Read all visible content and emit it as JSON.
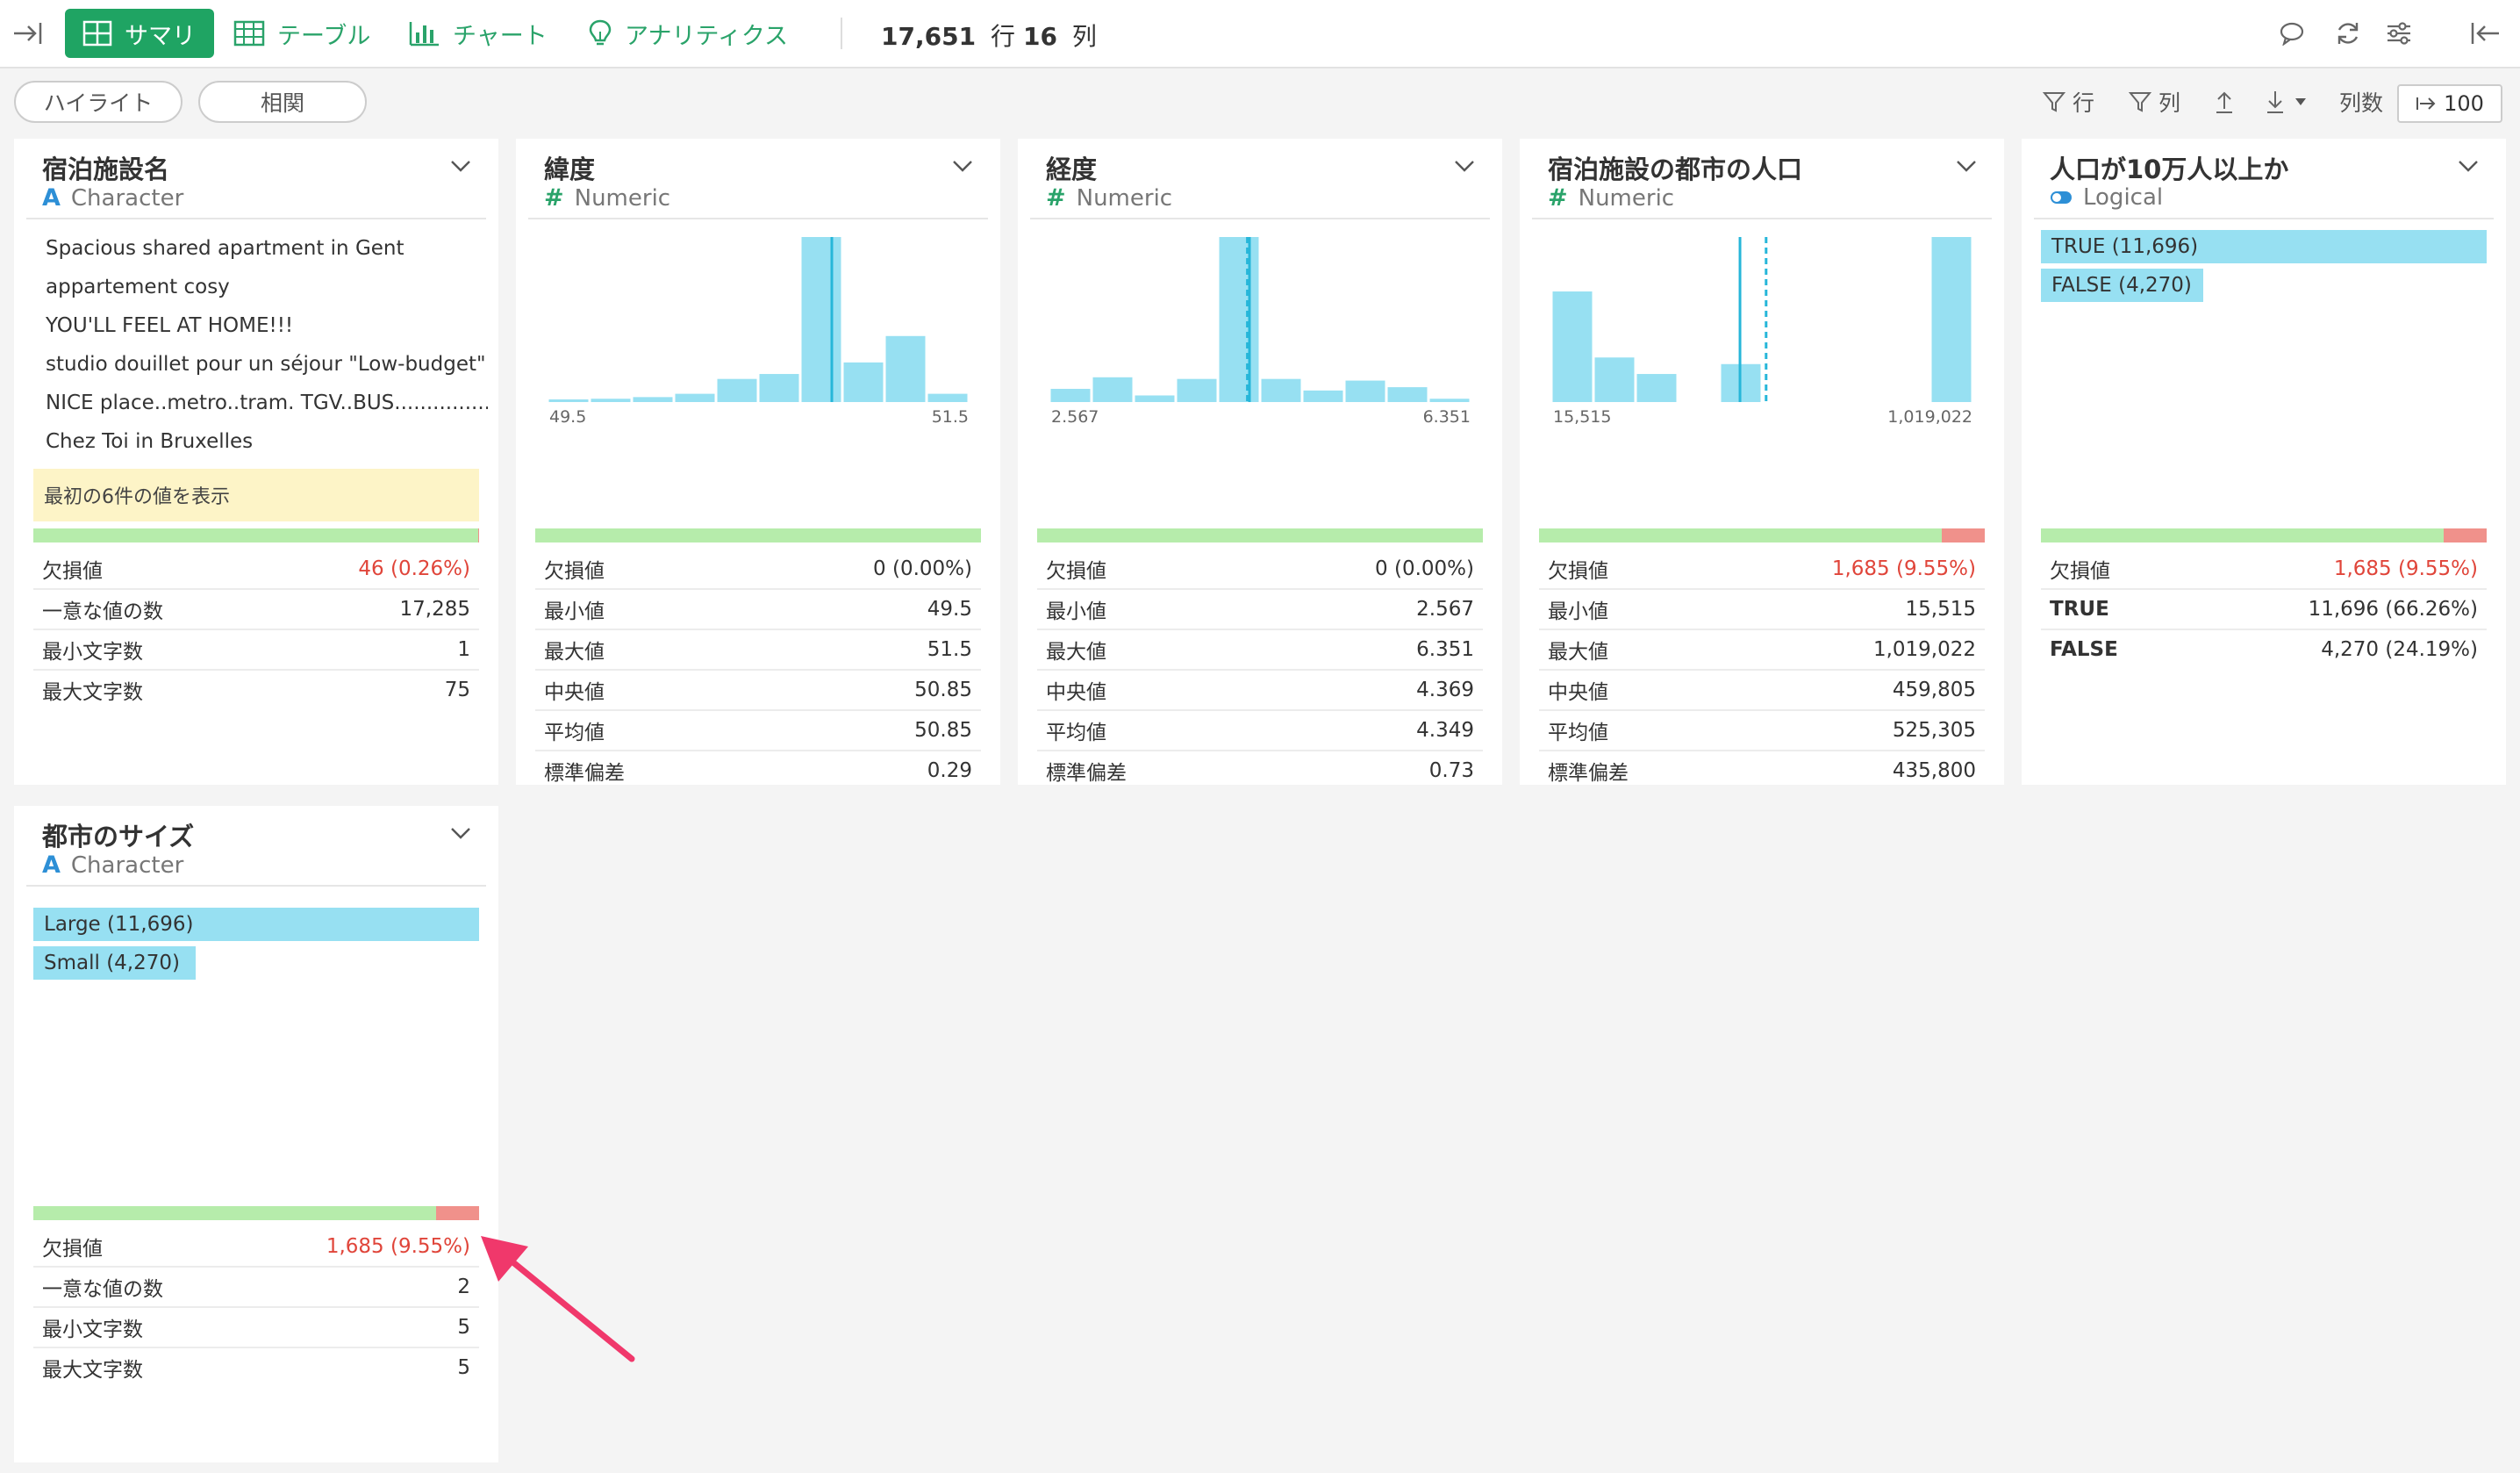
{
  "toolbar": {
    "tabs": [
      {
        "label": "サマリ",
        "active": true
      },
      {
        "label": "テーブル"
      },
      {
        "label": "チャート"
      },
      {
        "label": "アナリティクス"
      }
    ],
    "rows_count": "17,651",
    "rows_unit": "行",
    "cols_count": "16",
    "cols_unit": "列"
  },
  "subbar": {
    "highlight": "ハイライト",
    "correlation": "相関",
    "filter_rows": "行",
    "filter_cols": "列",
    "col_count_label": "列数",
    "col_limit": "100"
  },
  "colors": {
    "accent": "#1fa463",
    "bar": "#97e0f2",
    "median_line": "#26b6d9",
    "valid": "#b6ecab",
    "missing": "#f0918b",
    "missing_text": "#e0453a",
    "arrow": "#f0386b"
  },
  "cards": [
    {
      "title": "宿泊施設名",
      "type": "Character",
      "samples": [
        "Spacious shared apartment in Gent",
        "appartement cosy",
        "YOU'LL FEEL AT HOME!!!",
        "studio douillet pour un séjour \"Low-budget\"",
        "NICE place..metro..tram. TGV..BUS.................",
        "Chez Toi in Bruxelles"
      ],
      "note": "最初の6件の値を表示",
      "missing_fraction": 0.0026,
      "stats": [
        {
          "k": "欠損値",
          "v": "46 (0.26%)",
          "red": true
        },
        {
          "k": "一意な値の数",
          "v": "17,285"
        },
        {
          "k": "最小文字数",
          "v": "1"
        },
        {
          "k": "最大文字数",
          "v": "75"
        }
      ]
    },
    {
      "title": "緯度",
      "type": "Numeric",
      "hist": [
        0.01,
        0.02,
        0.03,
        0.05,
        0.14,
        0.17,
        1.0,
        0.24,
        0.4,
        0.05
      ],
      "median_pos": 0.675,
      "mean_pos": 0.675,
      "axis_min": "49.5",
      "axis_max": "51.5",
      "missing_fraction": 0,
      "stats": [
        {
          "k": "欠損値",
          "v": "0 (0.00%)"
        },
        {
          "k": "最小値",
          "v": "49.5"
        },
        {
          "k": "最大値",
          "v": "51.5"
        },
        {
          "k": "中央値",
          "v": "50.85"
        },
        {
          "k": "平均値",
          "v": "50.85"
        },
        {
          "k": "標準偏差",
          "v": "0.29"
        }
      ]
    },
    {
      "title": "経度",
      "type": "Numeric",
      "hist": [
        0.08,
        0.15,
        0.04,
        0.14,
        1.0,
        0.14,
        0.07,
        0.13,
        0.09,
        0.02
      ],
      "median_pos": 0.475,
      "mean_pos": 0.47,
      "axis_min": "2.567",
      "axis_max": "6.351",
      "missing_fraction": 0,
      "stats": [
        {
          "k": "欠損値",
          "v": "0 (0.00%)"
        },
        {
          "k": "最小値",
          "v": "2.567"
        },
        {
          "k": "最大値",
          "v": "6.351"
        },
        {
          "k": "中央値",
          "v": "4.369"
        },
        {
          "k": "平均値",
          "v": "4.349"
        },
        {
          "k": "標準偏差",
          "v": "0.73"
        }
      ]
    },
    {
      "title": "宿泊施設の都市の人口",
      "type": "Numeric",
      "hist": [
        0.67,
        0.27,
        0.17,
        0,
        0.23,
        0,
        0,
        0,
        0,
        1.0
      ],
      "median_pos": 0.448,
      "mean_pos": 0.51,
      "axis_min": "15,515",
      "axis_max": "1,019,022",
      "missing_fraction": 0.0955,
      "stats": [
        {
          "k": "欠損値",
          "v": "1,685 (9.55%)",
          "red": true
        },
        {
          "k": "最小値",
          "v": "15,515"
        },
        {
          "k": "最大値",
          "v": "1,019,022"
        },
        {
          "k": "中央値",
          "v": "459,805"
        },
        {
          "k": "平均値",
          "v": "525,305"
        },
        {
          "k": "標準偏差",
          "v": "435,800"
        }
      ]
    },
    {
      "title": "人口が10万人以上か",
      "type": "Logical",
      "categories": [
        {
          "label": "TRUE (11,696)",
          "fraction": 1.0
        },
        {
          "label": "FALSE (4,270)",
          "fraction": 0.365
        }
      ],
      "missing_fraction": 0.0955,
      "stats": [
        {
          "k": "欠損値",
          "v": "1,685 (9.55%)",
          "red": true
        },
        {
          "k": "TRUE",
          "v": "11,696 (66.26%)",
          "bold": true
        },
        {
          "k": "FALSE",
          "v": "4,270 (24.19%)",
          "bold": true
        }
      ]
    },
    {
      "title": "都市のサイズ",
      "type": "Character",
      "categories": [
        {
          "label": "Large (11,696)",
          "fraction": 1.0
        },
        {
          "label": "Small (4,270)",
          "fraction": 0.365
        }
      ],
      "missing_fraction": 0.0955,
      "stats": [
        {
          "k": "欠損値",
          "v": "1,685 (9.55%)",
          "red": true
        },
        {
          "k": "一意な値の数",
          "v": "2"
        },
        {
          "k": "最小文字数",
          "v": "5"
        },
        {
          "k": "最大文字数",
          "v": "5"
        }
      ]
    }
  ]
}
